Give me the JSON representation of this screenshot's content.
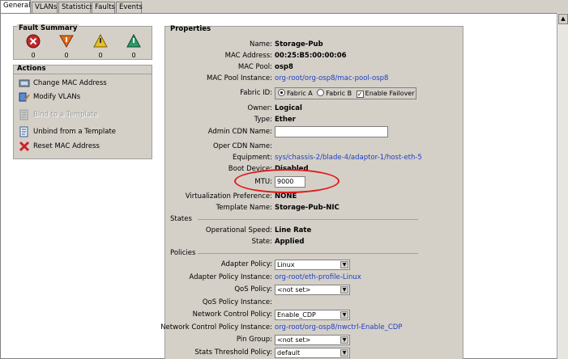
{
  "tabs": [
    "General",
    "VLANs",
    "Statistics",
    "Faults",
    "Events"
  ],
  "fault_summary": {
    "title": "Fault Summary",
    "counts": [
      "0",
      "0",
      "0",
      "0"
    ],
    "colors": [
      "#c0282a",
      "#e06a1a",
      "#e8c020",
      "#2a9a6a"
    ]
  },
  "actions": {
    "title": "Actions",
    "items": [
      {
        "label": "Change MAC Address",
        "enabled": true
      },
      {
        "label": "Modify VLANs",
        "enabled": true
      },
      {
        "label": "Bind to a Template",
        "enabled": false
      },
      {
        "label": "Unbind from a Template",
        "enabled": true
      },
      {
        "label": "Reset MAC Address",
        "enabled": true
      }
    ]
  },
  "properties": {
    "title": "Properties",
    "name": {
      "label": "Name:",
      "value": "Storage-Pub"
    },
    "mac_address": {
      "label": "MAC Address:",
      "value": "00:25:B5:00:00:06"
    },
    "mac_pool": {
      "label": "MAC Pool:",
      "value": "osp8"
    },
    "mac_pool_instance": {
      "label": "MAC Pool Instance:",
      "value": "org-root/org-osp8/mac-pool-osp8"
    },
    "fabric_id": {
      "label": "Fabric ID:",
      "fabric_a": "Fabric A",
      "fabric_b": "Fabric B",
      "failover": "Enable Failover"
    },
    "owner": {
      "label": "Owner:",
      "value": "Logical"
    },
    "type": {
      "label": "Type:",
      "value": "Ether"
    },
    "admin_cdn": {
      "label": "Admin CDN Name:",
      "value": ""
    },
    "oper_cdn": {
      "label": "Oper CDN Name:",
      "value": ""
    },
    "equipment": {
      "label": "Equipment:",
      "value": "sys/chassis-2/blade-4/adaptor-1/host-eth-5"
    },
    "boot_device": {
      "label": "Boot Device:",
      "value": "Disabled"
    },
    "mtu": {
      "label": "MTU:",
      "value": "9000"
    },
    "virt_pref": {
      "label": "Virtualization Preference:",
      "value": "NONE"
    },
    "template_name": {
      "label": "Template Name:",
      "value": "Storage-Pub-NIC"
    }
  },
  "states": {
    "title": "States",
    "op_speed": {
      "label": "Operational Speed:",
      "value": "Line Rate"
    },
    "state": {
      "label": "State:",
      "value": "Applied"
    }
  },
  "policies": {
    "title": "Policies",
    "adapter_policy": {
      "label": "Adapter Policy:",
      "value": "Linux"
    },
    "adapter_policy_instance": {
      "label": "Adapter Policy Instance:",
      "value": "org-root/eth-profile-Linux"
    },
    "qos_policy": {
      "label": "QoS Policy:",
      "value": "<not set>"
    },
    "qos_policy_instance": {
      "label": "QoS Policy Instance:",
      "value": ""
    },
    "net_ctrl_policy": {
      "label": "Network Control Policy:",
      "value": "Enable_CDP"
    },
    "net_ctrl_policy_instance": {
      "label": "Network Control Policy Instance:",
      "value": "org-root/org-osp8/nwctrl-Enable_CDP"
    },
    "pin_group": {
      "label": "Pin Group:",
      "value": "<not set>"
    },
    "stats_threshold": {
      "label": "Stats Threshold Policy:",
      "value": "default"
    }
  }
}
